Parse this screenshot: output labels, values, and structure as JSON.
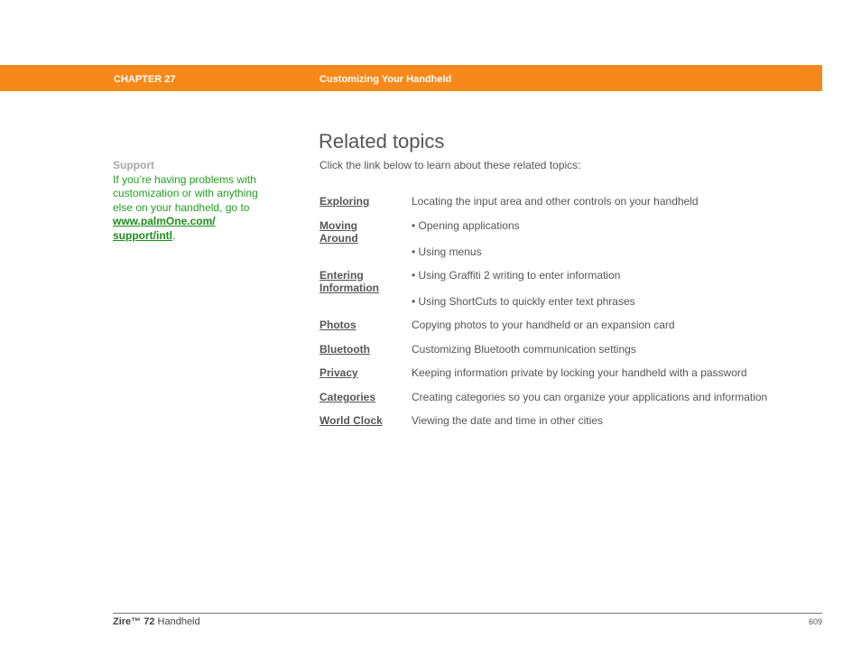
{
  "header": {
    "chapter": "CHAPTER 27",
    "title": "Customizing Your Handheld",
    "bar_color": "#f7891b"
  },
  "sidebar": {
    "heading": "Support",
    "text": "If you’re having problems with customization or with anything else on your handheld, go to ",
    "link": "www.palmOne.com/ support/intl",
    "trailing": "."
  },
  "main": {
    "title": "Related topics",
    "intro": "Click the link below to learn about these related topics:",
    "topics": [
      {
        "link": "Exploring",
        "items": [
          "Locating the input area and other controls on your handheld"
        ]
      },
      {
        "link": "Moving Around",
        "items": [
          "•  Opening applications",
          "•  Using menus"
        ]
      },
      {
        "link": "Entering Information",
        "items": [
          "•  Using Graffiti 2 writing to enter information",
          "•  Using ShortCuts to quickly enter text phrases"
        ]
      },
      {
        "link": "Photos",
        "items": [
          "Copying photos to your handheld or an expansion card"
        ]
      },
      {
        "link": "Bluetooth",
        "items": [
          "Customizing Bluetooth communication settings"
        ]
      },
      {
        "link": "Privacy",
        "items": [
          "Keeping information private by locking your handheld with a password"
        ]
      },
      {
        "link": "Categories",
        "items": [
          "Creating categories so you can organize your applications and information"
        ]
      },
      {
        "link": "World Clock",
        "items": [
          "Viewing the date and time in other cities"
        ]
      }
    ]
  },
  "footer": {
    "product_bold": "Zire™ 72",
    "product_rest": " Handheld",
    "page_number": "609"
  }
}
